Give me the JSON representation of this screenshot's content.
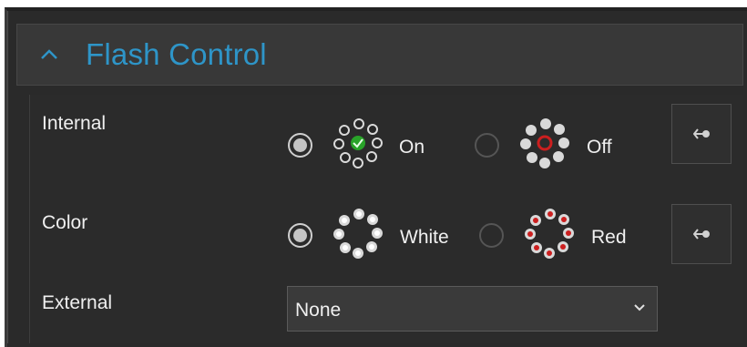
{
  "panel": {
    "title": "Flash Control",
    "collapse_icon": "chevron-up-icon",
    "accent_color": "#2e95c8"
  },
  "rows": {
    "internal": {
      "label": "Internal",
      "options": [
        {
          "label": "On",
          "selected": true,
          "icon": "flash-on-ring-icon",
          "status_color": "#29a329"
        },
        {
          "label": "Off",
          "selected": false,
          "icon": "flash-off-ring-icon",
          "status_color": "#cc1f1f"
        }
      ],
      "swap_icon": "swap-arrows-icon"
    },
    "color": {
      "label": "Color",
      "options": [
        {
          "label": "White",
          "selected": true,
          "icon": "white-led-ring-icon",
          "led_color": "#ffffff"
        },
        {
          "label": "Red",
          "selected": false,
          "icon": "red-led-ring-icon",
          "led_color": "#cc1f1f"
        }
      ],
      "swap_icon": "swap-arrows-icon"
    },
    "external": {
      "label": "External",
      "selected_value": "None",
      "dropdown_icon": "chevron-down-icon"
    }
  }
}
